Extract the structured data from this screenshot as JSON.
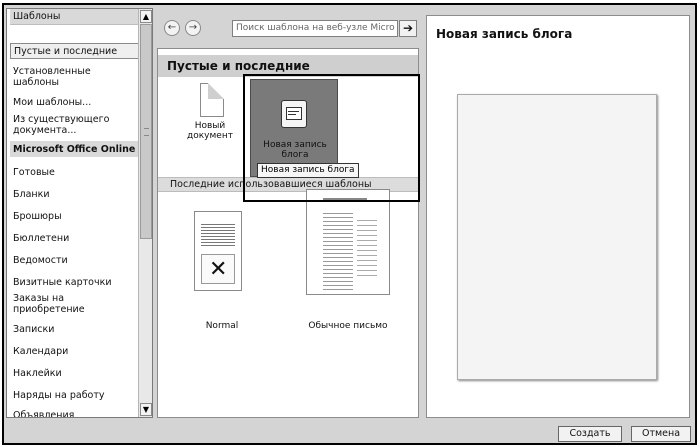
{
  "sidebar": {
    "header": "Шаблоны",
    "items": [
      {
        "label": "Пустые и последние"
      },
      {
        "label": "Установленные шаблоны"
      },
      {
        "label": "Мои шаблоны..."
      },
      {
        "label": "Из существующего документа..."
      },
      {
        "label": "Microsoft Office Online"
      },
      {
        "label": "Готовые"
      },
      {
        "label": "Бланки"
      },
      {
        "label": "Брошюры"
      },
      {
        "label": "Бюллетени"
      },
      {
        "label": "Ведомости"
      },
      {
        "label": "Визитные карточки"
      },
      {
        "label": "Заказы на приобретение"
      },
      {
        "label": "Записки"
      },
      {
        "label": "Календари"
      },
      {
        "label": "Наклейки"
      },
      {
        "label": "Наряды на работу"
      },
      {
        "label": "Объявления"
      }
    ],
    "scroll_up": "▲",
    "scroll_down": "▼"
  },
  "toolbar": {
    "back": "←",
    "forward": "→",
    "search_placeholder": "Поиск шаблона на веб-узле Micro",
    "search_go": "➔"
  },
  "main": {
    "section_title": "Пустые и последние",
    "templates": [
      {
        "label_line1": "Новый",
        "label_line2": "документ"
      },
      {
        "label_line1": "Новая запись",
        "label_line2": "блога"
      }
    ],
    "recent_header": "Последние использовавшиеся шаблоны",
    "recent": [
      {
        "label": "Normal"
      },
      {
        "label": "Обычное письмо"
      }
    ],
    "tooltip": "Новая запись блога"
  },
  "preview": {
    "title": "Новая запись блога"
  },
  "buttons": {
    "create": "Создать",
    "cancel": "Отмена"
  }
}
